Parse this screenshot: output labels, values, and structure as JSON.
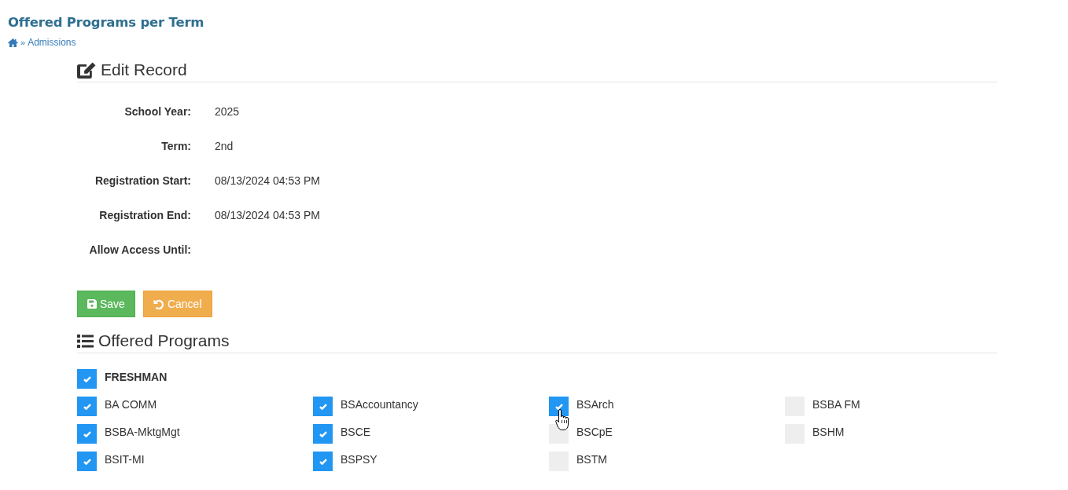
{
  "page_header": {
    "title": "Offered Programs per Term",
    "breadcrumb": {
      "separator": "»",
      "items": [
        {
          "kind": "home"
        },
        {
          "kind": "link",
          "label": "Admissions"
        }
      ]
    }
  },
  "edit_section": {
    "heading": "Edit Record",
    "fields": [
      {
        "label": "School Year:",
        "value": "2025"
      },
      {
        "label": "Term:",
        "value": "2nd"
      },
      {
        "label": "Registration Start:",
        "value": "08/13/2024 04:53 PM"
      },
      {
        "label": "Registration End:",
        "value": "08/13/2024 04:53 PM"
      },
      {
        "label": "Allow Access Until:"
      }
    ]
  },
  "buttons": [
    {
      "kind": "save",
      "label": "Save"
    },
    {
      "kind": "cancel",
      "label": "Cancel"
    }
  ],
  "programs_section": {
    "heading": "Offered Programs",
    "group": {
      "label": "FRESHMAN",
      "checked": true
    },
    "programs": [
      {
        "label": "BA COMM",
        "checked": true
      },
      {
        "label": "BSAccountancy",
        "checked": true
      },
      {
        "label": "BSArch",
        "checked": true
      },
      {
        "label": "BSBA FM",
        "checked": false
      },
      {
        "label": "BSBA-MktgMgt",
        "checked": true
      },
      {
        "label": "BSCE",
        "checked": true
      },
      {
        "label": "BSCpE",
        "checked": false
      },
      {
        "label": "BSHM",
        "checked": false
      },
      {
        "label": "BSIT-MI",
        "checked": true
      },
      {
        "label": "BSPSY",
        "checked": true
      },
      {
        "label": "BSTM",
        "checked": false
      }
    ]
  }
}
